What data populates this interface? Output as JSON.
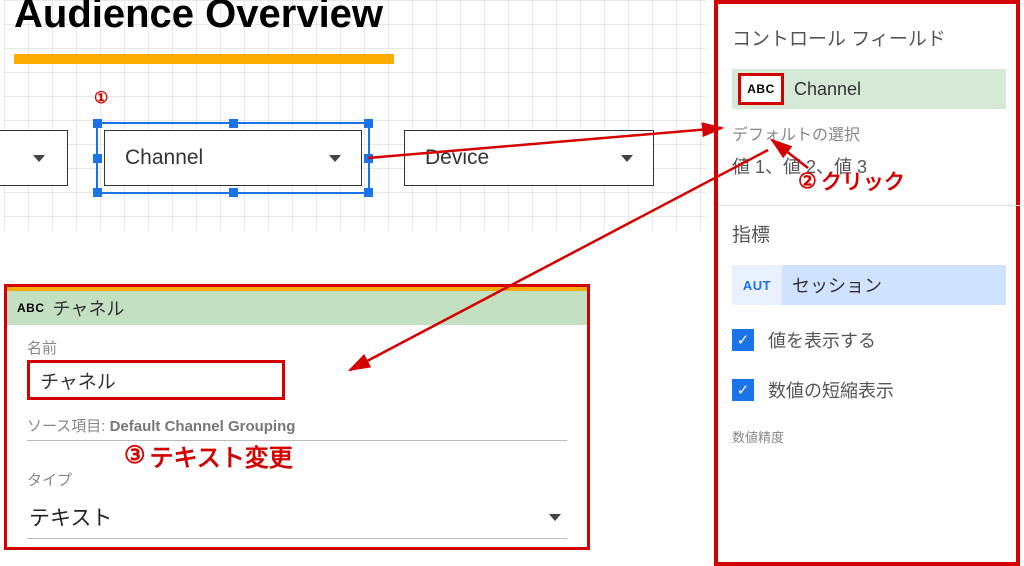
{
  "canvas": {
    "title": "Audience Overview",
    "dropdowns": {
      "channel": "Channel",
      "device": "Device"
    }
  },
  "field_editor": {
    "badge": "ABC",
    "header_value": "チャネル",
    "name_label": "名前",
    "name_value": "チャネル",
    "source_label": "ソース項目:",
    "source_value": "Default Channel Grouping",
    "type_label": "タイプ",
    "type_value": "テキスト"
  },
  "right_panel": {
    "control_field_title": "コントロール フィールド",
    "abc": "ABC",
    "field_name": "Channel",
    "default_select_label": "デフォルトの選択",
    "values_hint": "値 1、値 2、値 3",
    "metric_title": "指標",
    "aut": "AUT",
    "metric_name": "セッション",
    "check_show_value": "値を表示する",
    "check_abbrev": "数値の短縮表示",
    "precision_label": "数値精度"
  },
  "annotations": {
    "a1": "①",
    "a2_num": "②",
    "a2_text": "クリック",
    "a3_num": "③",
    "a3_text": "テキスト変更"
  }
}
